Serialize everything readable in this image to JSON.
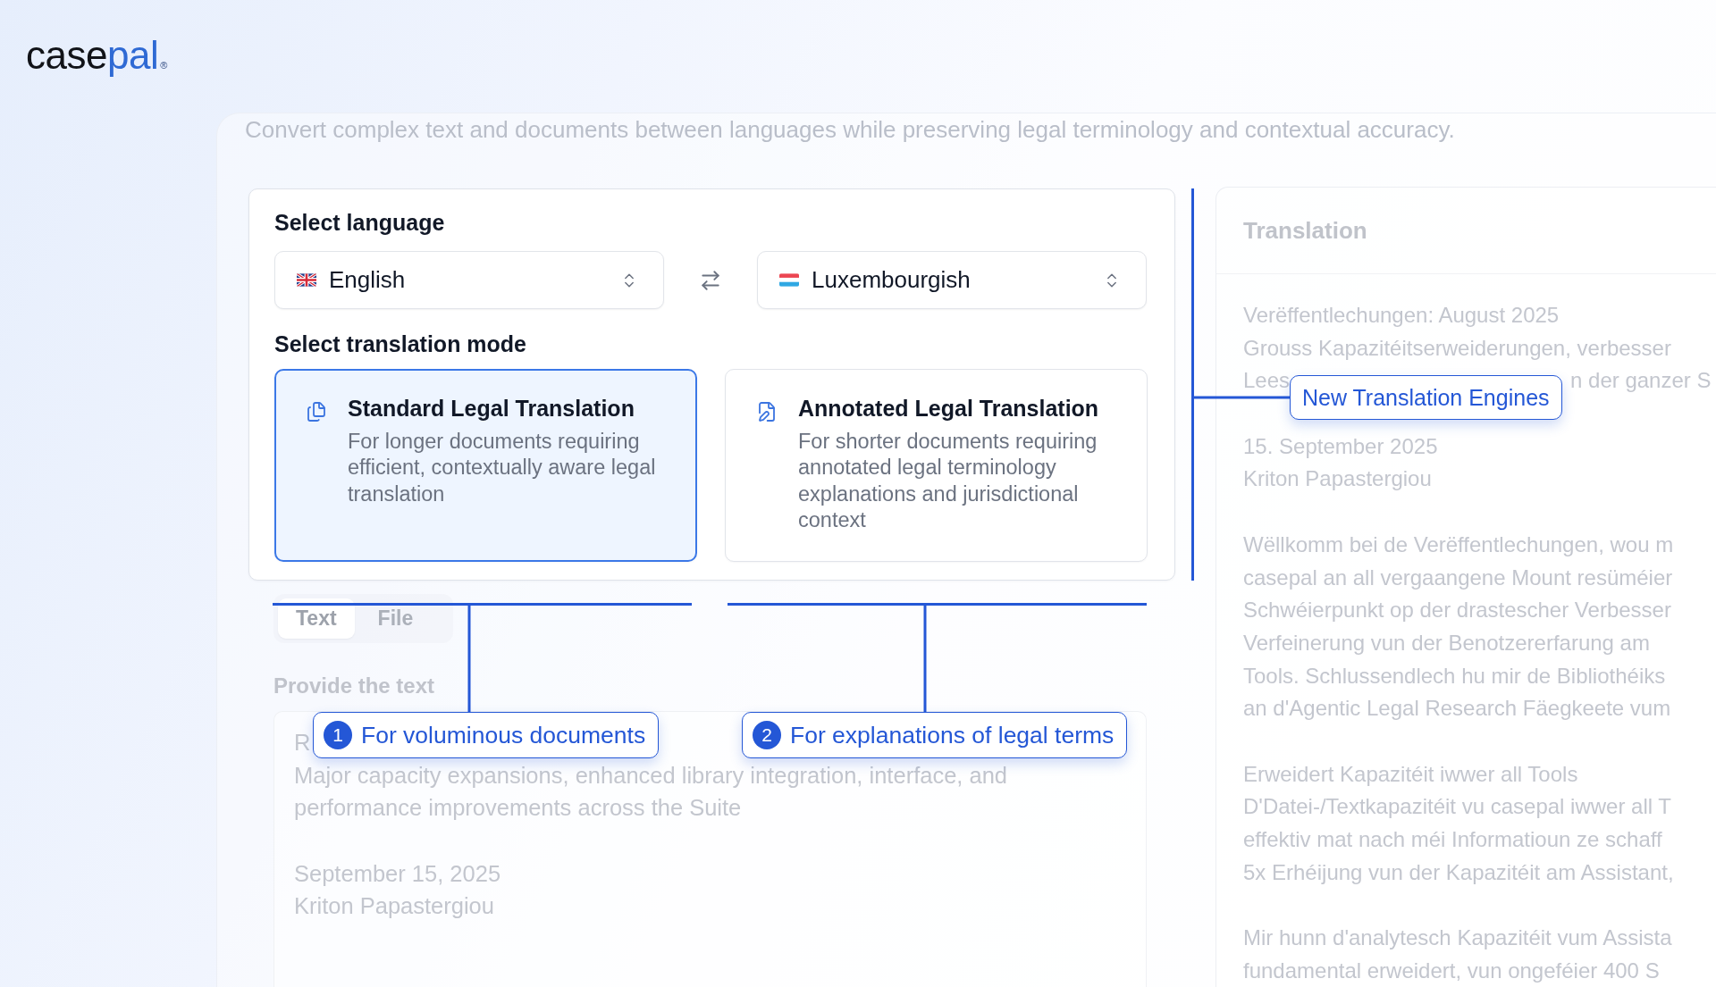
{
  "logo": {
    "parts": [
      "case",
      "pal"
    ],
    "mark": "®"
  },
  "subtitle": "Convert complex text and documents between languages while preserving legal terminology and contextual accuracy.",
  "language": {
    "label": "Select language",
    "source": "English",
    "target": "Luxembourgish"
  },
  "mode": {
    "label": "Select translation mode",
    "options": [
      {
        "title": "Standard Legal Translation",
        "description": "For longer documents requiring efficient, contextually aware legal translation",
        "selected": true,
        "callout": {
          "number": "1",
          "text": "For voluminous documents"
        }
      },
      {
        "title": "Annotated Legal Translation",
        "description": "For shorter documents requiring annotated legal terminology explanations and jurisdictional context",
        "selected": false,
        "callout": {
          "number": "2",
          "text": "For explanations of legal terms"
        }
      }
    ]
  },
  "input": {
    "tabs": [
      {
        "label": "Text",
        "selected": true
      },
      {
        "label": "File",
        "selected": false
      }
    ],
    "label": "Provide the text",
    "blocks": [
      {
        "lines": [
          [
            "R"
          ],
          [
            "Major capacity expansions, enhanced library integration, interface, and"
          ],
          [
            "performance improvements across the Suite"
          ]
        ]
      },
      {
        "lines": [
          [
            "September 15, 2025"
          ],
          [
            "Kriton Papastergiou"
          ]
        ]
      }
    ]
  },
  "translation": {
    "title": "Translation",
    "callout": "New Translation Engines",
    "blocks": [
      {
        "lines": [
          [
            "Verëffentlechungen: August 2025"
          ],
          [
            "Grouss Kapazitéitserweiderungen, verbesser"
          ],
          [
            "Lees",
            "n der ganzer S"
          ]
        ]
      },
      {
        "lines": [
          [
            "15. September 2025"
          ],
          [
            "Kriton Papastergiou"
          ]
        ]
      },
      {
        "lines": [
          [
            "Wëllkomm bei de Verëffentlechungen, wou m"
          ],
          [
            "casepal an all vergaangene Mount resüméier"
          ],
          [
            "Schwéierpunkt op der drastescher Verbesser"
          ],
          [
            "Verfeinerung vun der Benotzererfarung am"
          ],
          [
            "Tools. Schlussendlech hu mir de Bibliothéiks"
          ],
          [
            "an d'Agentic Legal Research Fäegkeete vum"
          ]
        ]
      },
      {
        "lines": [
          [
            "Erweidert Kapazitéit iwwer all Tools"
          ],
          [
            "D'Datei-/Textkapazitéit vu casepal iwwer all T"
          ],
          [
            "effektiv mat nach méi Informatioun ze schaff"
          ],
          [
            "5x Erhéijung vun der Kapazitéit am Assistant,"
          ]
        ]
      },
      {
        "lines": [
          [
            "Mir hunn d'analytesch Kapazitéit vum Assista"
          ],
          [
            "fundamental erweidert, vun ongeféier 400 S"
          ]
        ]
      }
    ]
  }
}
